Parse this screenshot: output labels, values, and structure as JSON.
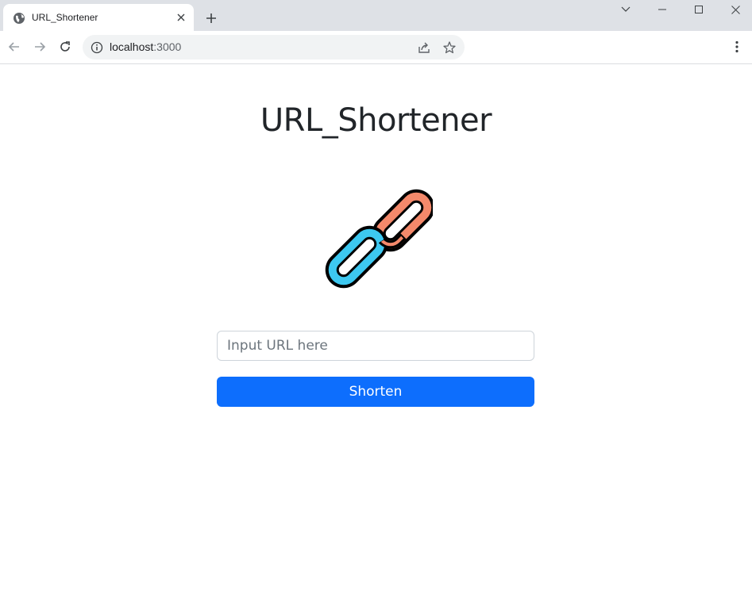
{
  "browser": {
    "tab": {
      "title": "URL_Shortener"
    },
    "address": {
      "host": "localhost",
      "port": ":3000"
    }
  },
  "page": {
    "title": "URL_Shortener",
    "logo_icon": "chain-link-icon",
    "input": {
      "placeholder": "Input URL here",
      "value": ""
    },
    "button_label": "Shorten"
  },
  "colors": {
    "link_orange": "#f4896b",
    "link_blue": "#3dc8f0",
    "button_blue": "#0d6efd"
  }
}
